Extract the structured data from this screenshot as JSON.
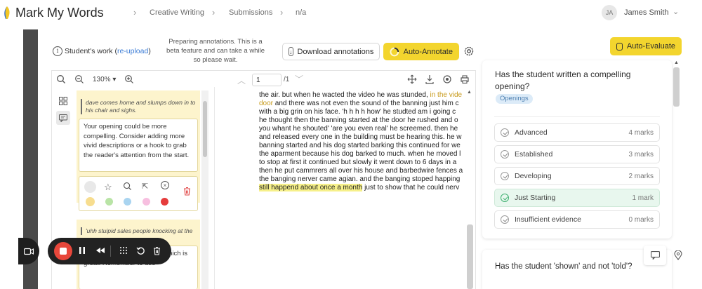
{
  "app": {
    "title": "Mark My Words",
    "breadcrumbs": [
      "Creative Writing",
      "Submissions",
      "n/a"
    ],
    "user": {
      "initials": "JA",
      "name": "James Smith"
    }
  },
  "toolbar": {
    "student_work_label": "Student's work (",
    "reupload_link": "re-upload",
    "student_work_close": ")",
    "preparing_lines": [
      "Preparing annotations. This is a",
      "beta feature and can take a while",
      "so please wait."
    ],
    "download_label": "Download annotations",
    "auto_annotate_label": "Auto-Annotate",
    "auto_evaluate_label": "Auto-Evaluate"
  },
  "viewer": {
    "zoom": "130%",
    "page_value": "1",
    "page_total": "/1"
  },
  "comments": [
    {
      "quote": "dave comes home and slumps down in to his chair and sighs.",
      "text": "Your opening could be more compelling. Consider adding more vivid descriptions or a hook to grab the reader's attention from the start."
    },
    {
      "quote": "'uhh stuipid sales people knocking at the",
      "text_fragments": [
        "hich is",
        "great. Remember to use"
      ]
    }
  ],
  "palette": [
    "#f7dd8f",
    "#b9e4a6",
    "#a9d4f0",
    "#f7bfe0",
    "#e53c3c"
  ],
  "document": {
    "lines": [
      {
        "t": "the air. but when he wacted the video he was stunded, ",
        "h": "in the vide"
      },
      {
        "t": "",
        "h": "door",
        "t2": " and there was not even the sound of the banning just him c"
      },
      {
        "t": "with a big grin on his face.  'h h h h how' he studted am i going c"
      },
      {
        "t": "he thought then the banning started at the door he rushed and o"
      },
      {
        "t": "you whant he shouted' 'are you even real' he screemed. then he"
      },
      {
        "t": "and released every one in the building must be hearing this. he w"
      },
      {
        "t": "banning started and his dog started barking this continued for we"
      },
      {
        "t": "the aparment because his dog barked to much. when he moved l"
      },
      {
        "t": "to stop at first it continued but slowly it went down to 6 days in a"
      },
      {
        "t": "then he put cammrers all over his house and barbedwire fences a"
      },
      {
        "t": "the banging nerver came agian. and the banging stoped happing"
      },
      {
        "t": "",
        "y": "still happend about once a month",
        "t2": " just to show that he could nerv"
      }
    ]
  },
  "rubric": [
    {
      "question": "Has the student written a compelling opening?",
      "tag": "Openings",
      "options": [
        {
          "label": "Advanced",
          "marks": "4 marks"
        },
        {
          "label": "Established",
          "marks": "3 marks"
        },
        {
          "label": "Developing",
          "marks": "2 marks"
        },
        {
          "label": "Just Starting",
          "marks": "1 mark",
          "selected": true
        },
        {
          "label": "Insufficient evidence",
          "marks": "0 marks"
        }
      ]
    },
    {
      "question": "Has the student 'shown' and not 'told'?"
    }
  ],
  "colors": {
    "accent_yellow": "#f3d52e",
    "comment_bg": "#fdf4cd",
    "selected_green": "#e8f7ee",
    "tag_blue": "#dcebf8",
    "recorder_bg": "#222222",
    "stop_red": "#e8473b",
    "side_strip": "#4a4a4a"
  }
}
